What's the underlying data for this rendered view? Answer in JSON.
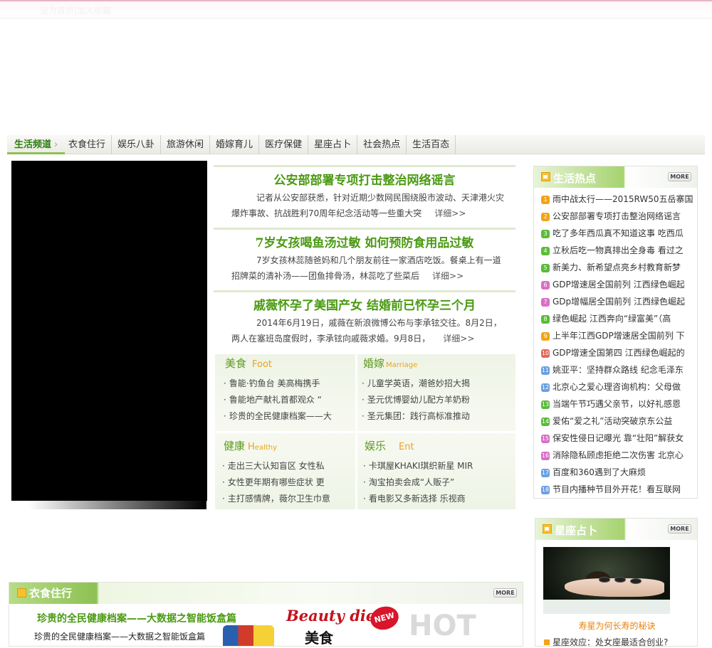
{
  "topbar": {
    "home_link": "设为首页|加入收藏"
  },
  "nav": {
    "current": "生活频道",
    "items": [
      "衣食住行",
      "娱乐八卦",
      "旅游休闲",
      "婚嫁育儿",
      "医疗保健",
      "星座占卜",
      "社会热点",
      "生活百态"
    ]
  },
  "headlines": [
    {
      "title": "公安部部署专项打击整治网络谣言",
      "summary": "记者从公安部获悉，针对近期少数网民围绕股市波动、天津港火灾爆炸事故、抗战胜利70周年纪念活动等一些重大突",
      "more": "详细>>"
    },
    {
      "title": "7岁女孩喝鱼汤过敏 如何预防食用品过敏",
      "summary": "7岁女孩林蕊随爸妈和几个朋友前往一家酒店吃饭。餐桌上有一道招牌菜的清补汤——团鱼排骨汤，林蕊吃了些菜后",
      "more": "详细>>"
    },
    {
      "title": "戚薇怀孕了美国产女 结婚前已怀孕三个月",
      "summary": "2014年6月19日，戚薇在新浪微博公布与李承铉交往。8月2日，两人在塞班岛度假时，李承铉向戚薇求婚。9月8日，",
      "more": "详细>>"
    }
  ],
  "categories": {
    "food": {
      "title": "美食",
      "en": "Foot",
      "items": [
        "鲁能·钓鱼台 美高梅携手",
        "鲁能地产献礼首都观众 “",
        "珍贵的全民健康档案——大"
      ]
    },
    "marriage": {
      "title": "婚嫁",
      "en": "Marriage",
      "items": [
        "儿童学英语，潮爸妙招大揭",
        "圣元优博婴幼儿配方羊奶粉",
        "圣元集团：践行高标准推动"
      ]
    },
    "health": {
      "title": "健康",
      "en_initial": "H",
      "en": "ealthy",
      "items": [
        "走出三大认知盲区 女性私",
        "女性更年期有哪些症状 更",
        "主打感情牌，薇尔卫生巾意"
      ]
    },
    "ent": {
      "title": "娱乐",
      "en": "Ent",
      "items": [
        "卡琪屋KHAKI琪织新星 MIR",
        "淘宝拍卖会成“人贩子”",
        "看电影又多新选择 乐视商"
      ]
    }
  },
  "hot": {
    "title": "生活热点",
    "more": "MORE",
    "num_colors": [
      "#f2a31b",
      "#f2a31b",
      "#5cbb3a",
      "#5cbb3a",
      "#5cbb3a",
      "#d96fc6",
      "#d96fc6",
      "#5cbb3a",
      "#f2a31b",
      "#e5665b",
      "#6aa0e3",
      "#6aa0e3",
      "#5cbb3a",
      "#5cbb3a",
      "#d96fc6",
      "#d96fc6",
      "#6aa0e3",
      "#6aa0e3"
    ],
    "items": [
      {
        "n": "1",
        "text": "雨中战太行——2015RW50五岳寨国"
      },
      {
        "n": "2",
        "text": "公安部部署专项打击整治网络谣言"
      },
      {
        "n": "3",
        "text": "吃了多年西瓜真不知道这事 吃西瓜"
      },
      {
        "n": "4",
        "text": "立秋后吃一物真排出全身毒 看过之"
      },
      {
        "n": "5",
        "text": "新美力、新希望点亮乡村教育新梦"
      },
      {
        "n": "6",
        "text": "GDP增速居全国前列 江西绿色崛起"
      },
      {
        "n": "7",
        "text": "GDp增幅居全国前列 江西绿色崛起"
      },
      {
        "n": "8",
        "text": "绿色崛起 江西奔向“绿富美”（高"
      },
      {
        "n": "9",
        "text": "上半年江西GDP增速居全国前列 下"
      },
      {
        "n": "10",
        "text": "GDP增速全国第四 江西绿色崛起的"
      },
      {
        "n": "11",
        "text": "姚亚平：坚持群众路线 纪念毛泽东"
      },
      {
        "n": "12",
        "text": "北京心之爱心理咨询机构：父母做"
      },
      {
        "n": "13",
        "text": "当端午节巧遇父亲节，以好礼感恩"
      },
      {
        "n": "14",
        "text": "爱佑“爱之礼”活动突破京东公益"
      },
      {
        "n": "15",
        "text": "保安性侵日记曝光 靠“壮阳”解获女"
      },
      {
        "n": "16",
        "text": "消除隐私顾虑拒绝二次伤害 北京心"
      },
      {
        "n": "17",
        "text": "百度和360遇到了大麻烦"
      },
      {
        "n": "18",
        "text": "节目内播种节目外开花！看互联网"
      }
    ]
  },
  "stars": {
    "title": "星座占卜",
    "more": "MORE",
    "caption": "寿星为何长寿的秘诀",
    "link": "星座效应：处女座最适合创业?"
  },
  "food_section": {
    "title": "衣食住行",
    "more": "MORE",
    "headline": "珍贵的全民健康档案——大数据之智能饭盒篇",
    "sub": "珍贵的全民健康档案——大数据之智能饭盒篇",
    "banner": {
      "script": "Beauty diet",
      "badge": "NEW",
      "cn": "美食",
      "hot": "HOT"
    }
  }
}
